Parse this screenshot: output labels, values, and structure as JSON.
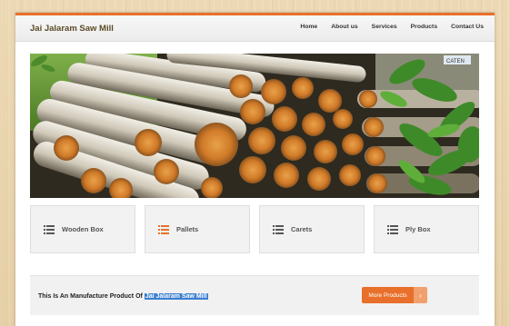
{
  "site": {
    "logo": "Jai Jalaram Saw Mill",
    "accent_color": "#e8702a"
  },
  "nav": {
    "items": [
      "Home",
      "About us",
      "Services",
      "Products",
      "Contact Us"
    ]
  },
  "hero": {
    "image": "stacked timber logs with green leaves",
    "sign_text": "CATEN"
  },
  "cards": [
    {
      "label": "Wooden Box",
      "icon": "list-icon",
      "icon_color": "#555555"
    },
    {
      "label": "Pallets",
      "icon": "list-icon",
      "icon_color": "#e8702a"
    },
    {
      "label": "Carets",
      "icon": "list-icon",
      "icon_color": "#555555"
    },
    {
      "label": "Ply Box",
      "icon": "list-icon",
      "icon_color": "#555555"
    }
  ],
  "cta": {
    "text_prefix": "This Is An Manufacture Product Of ",
    "text_highlight": "Jai Jalaram Saw Mill",
    "button_label": "More Products",
    "button_arrow": "›"
  }
}
